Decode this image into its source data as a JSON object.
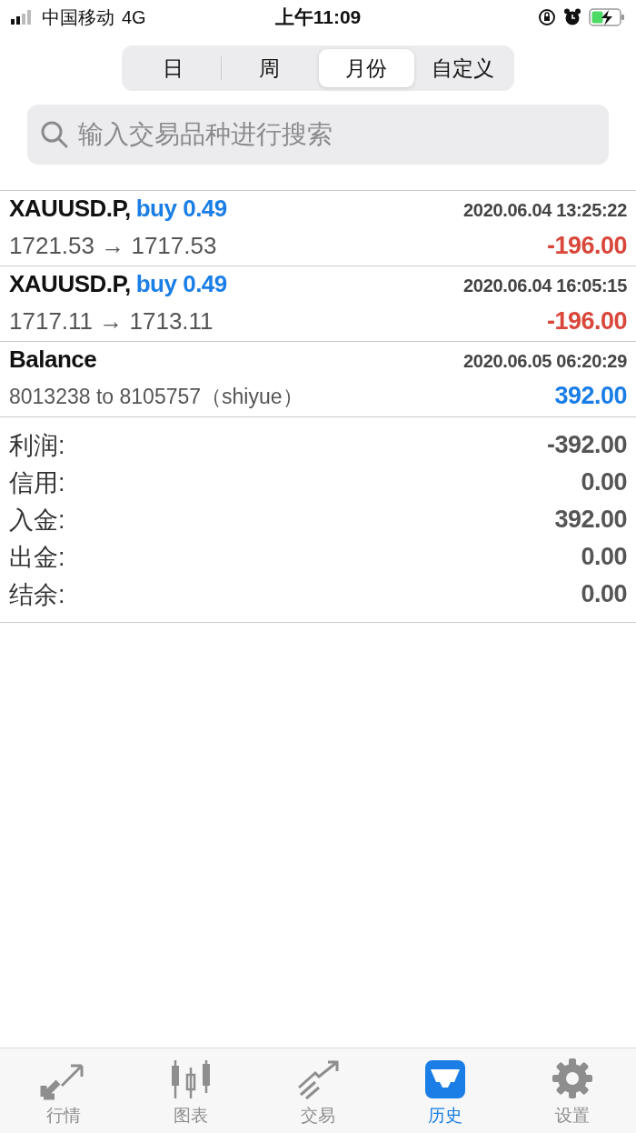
{
  "status_bar": {
    "carrier": "中国移动",
    "network": "4G",
    "time": "上午11:09"
  },
  "periods": [
    {
      "label": "日",
      "selected": false
    },
    {
      "label": "周",
      "selected": false
    },
    {
      "label": "月份",
      "selected": true
    },
    {
      "label": "自定义",
      "selected": false
    }
  ],
  "search": {
    "placeholder": "输入交易品种进行搜索"
  },
  "deals": [
    {
      "kind": "trade",
      "symbol": "XAUUSD.P,",
      "side": "buy 0.49",
      "time": "2020.06.04 13:25:22",
      "detail": "1721.53 → 1717.53",
      "profit": "-196.00",
      "color": "#d9473b"
    },
    {
      "kind": "trade",
      "symbol": "XAUUSD.P,",
      "side": "buy 0.49",
      "time": "2020.06.04 16:05:15",
      "detail": "1717.11 → 1713.11",
      "profit": "-196.00",
      "color": "#d9473b"
    },
    {
      "kind": "balance",
      "symbol": "Balance",
      "time": "2020.06.05 06:20:29",
      "detail": "8013238 to 8105757（shiyue）",
      "profit": "392.00",
      "color": "#1a7ee6"
    }
  ],
  "summary": [
    {
      "label": "利润:",
      "value": "-392.00"
    },
    {
      "label": "信用:",
      "value": "0.00"
    },
    {
      "label": "入金:",
      "value": "392.00"
    },
    {
      "label": "出金:",
      "value": "0.00"
    },
    {
      "label": "结余:",
      "value": "0.00"
    }
  ],
  "tab_bar": [
    {
      "kind": "quotes",
      "label": "行情",
      "selected": false
    },
    {
      "kind": "chart",
      "label": "图表",
      "selected": false
    },
    {
      "kind": "trade",
      "label": "交易",
      "selected": false
    },
    {
      "kind": "history",
      "label": "历史",
      "selected": true
    },
    {
      "kind": "settings",
      "label": "设置",
      "selected": false
    }
  ]
}
